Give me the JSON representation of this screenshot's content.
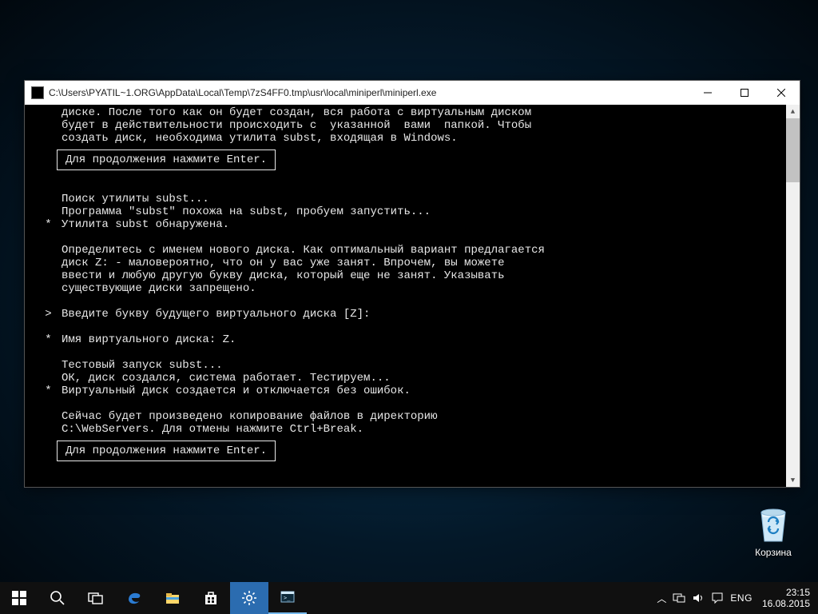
{
  "window": {
    "title": "C:\\Users\\PYATIL~1.ORG\\AppData\\Local\\Temp\\7zS4FF0.tmp\\usr\\local\\miniperl\\miniperl.exe"
  },
  "console": {
    "lines": [
      {
        "g": "  ",
        "t": "диске. После того как он будет создан, вся работа с виртуальным диском"
      },
      {
        "g": "  ",
        "t": "будет в действительности происходить с  указанной  вами  папкой. Чтобы"
      },
      {
        "g": "  ",
        "t": "создать диск, необходима утилита subst, входящая в Windows."
      }
    ],
    "prompt1": "Для продолжения нажмите Enter.",
    "lines2": [
      {
        "g": "  ",
        "t": "Поиск утилиты subst..."
      },
      {
        "g": "  ",
        "t": "Программа \"subst\" похожа на subst, пробуем запустить..."
      },
      {
        "g": "* ",
        "t": "Утилита subst обнаружена."
      },
      {
        "g": "  ",
        "t": ""
      },
      {
        "g": "  ",
        "t": "Определитесь с именем нового диска. Как оптимальный вариант предлагается"
      },
      {
        "g": "  ",
        "t": "диск Z: - маловероятно, что он у вас уже занят. Впрочем, вы можете"
      },
      {
        "g": "  ",
        "t": "ввести и любую другую букву диска, который еще не занят. Указывать"
      },
      {
        "g": "  ",
        "t": "существующие диски запрещено."
      },
      {
        "g": "  ",
        "t": ""
      },
      {
        "g": "> ",
        "t": "Введите букву будущего виртуального диска [Z]:"
      },
      {
        "g": "  ",
        "t": ""
      },
      {
        "g": "* ",
        "t": "Имя виртуального диска: Z."
      },
      {
        "g": "  ",
        "t": ""
      },
      {
        "g": "  ",
        "t": "Тестовый запуск subst..."
      },
      {
        "g": "  ",
        "t": "ОК, диск создался, система работает. Тестируем..."
      },
      {
        "g": "* ",
        "t": "Виртуальный диск создается и отключается без ошибок."
      },
      {
        "g": "  ",
        "t": ""
      },
      {
        "g": "  ",
        "t": "Сейчас будет произведено копирование файлов в директорию"
      },
      {
        "g": "  ",
        "t": "C:\\WebServers. Для отмены нажмите Ctrl+Break."
      }
    ],
    "prompt2": "Для продолжения нажмите Enter."
  },
  "desktop": {
    "recycle": "Корзина"
  },
  "taskbar": {
    "lang": "ENG",
    "time": "23:15",
    "date": "16.08.2015"
  }
}
